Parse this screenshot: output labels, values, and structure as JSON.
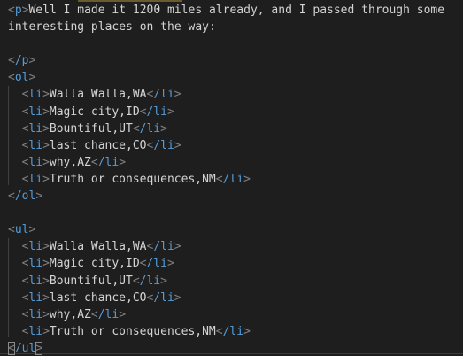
{
  "colors": {
    "background": "#1e1e1e",
    "tag": "#569cd6",
    "punctuation": "#808080",
    "text": "#d4d4d4"
  },
  "p_block": {
    "open_tag": "p",
    "text_line1": "Well I made it 1200 miles already, and I passed through some",
    "text_line2": "interesting places on the way:",
    "close_tag": "/p"
  },
  "ol_block": {
    "open_tag": "ol",
    "close_tag": "/ol",
    "item_tag": "li",
    "item_close_tag": "/li",
    "items": [
      "Walla Walla,WA",
      "Magic city,ID",
      "Bountiful,UT",
      "last chance,CO",
      "why,AZ",
      "Truth or consequences,NM"
    ]
  },
  "ul_block": {
    "open_tag": "ul",
    "close_tag": "/ul",
    "item_tag": "li",
    "item_close_tag": "/li",
    "items": [
      "Walla Walla,WA",
      "Magic city,ID",
      "Bountiful,UT",
      "last chance,CO",
      "why,AZ",
      "Truth or consequences,NM"
    ]
  }
}
